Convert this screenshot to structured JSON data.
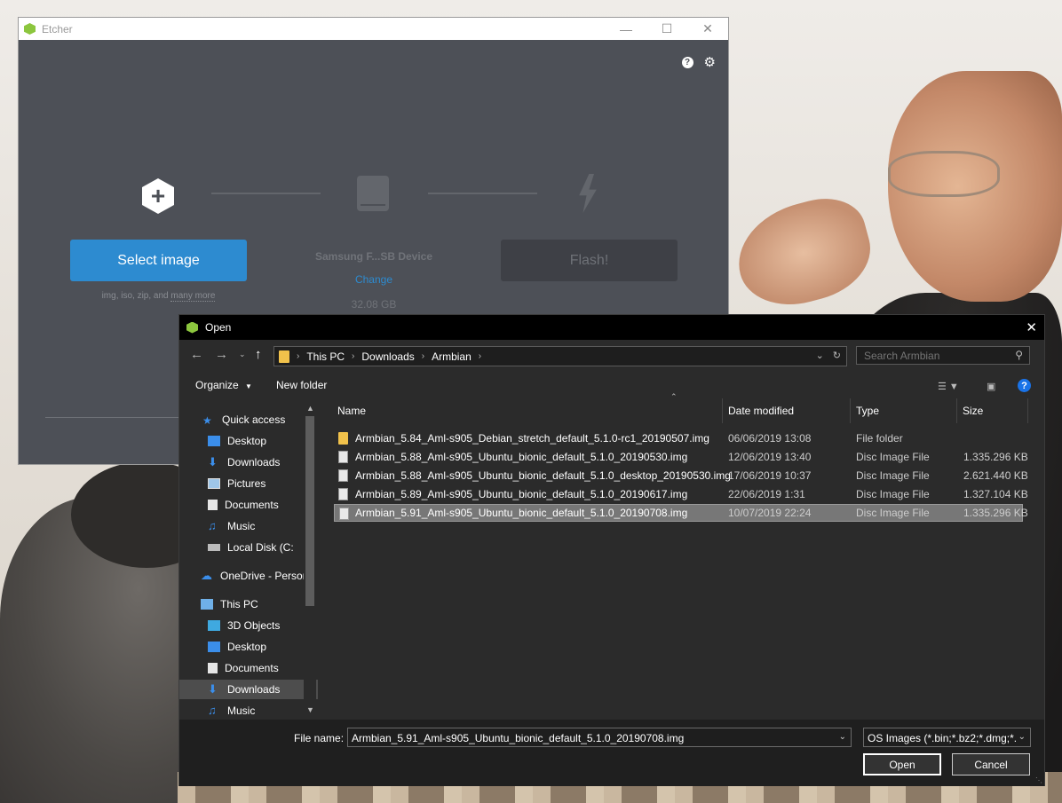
{
  "etcher": {
    "title": "Etcher",
    "help_icon_label": "?",
    "select_image_label": "Select image",
    "formats_text": "img, iso, zip, and",
    "formats_more": "many more",
    "drive_name": "Samsung F...SB Device",
    "drive_change": "Change",
    "drive_size": "32.08 GB",
    "flash_label": "Flash!"
  },
  "dialog": {
    "title": "Open",
    "breadcrumb": [
      "This PC",
      "Downloads",
      "Armbian"
    ],
    "search_placeholder": "Search Armbian",
    "organize_label": "Organize",
    "new_folder_label": "New folder",
    "help_label": "?",
    "nav": {
      "quick_access": "Quick access",
      "desktop": "Desktop",
      "downloads": "Downloads",
      "pictures": "Pictures",
      "documents": "Documents",
      "music": "Music",
      "local_disk": "Local Disk (C:",
      "onedrive": "OneDrive - Persor",
      "this_pc": "This PC",
      "objects3d": "3D Objects",
      "pc_desktop": "Desktop",
      "pc_documents": "Documents",
      "pc_downloads": "Downloads",
      "pc_music": "Music"
    },
    "columns": {
      "name": "Name",
      "date": "Date modified",
      "type": "Type",
      "size": "Size"
    },
    "files": [
      {
        "name": "Armbian_5.84_Aml-s905_Debian_stretch_default_5.1.0-rc1_20190507.img",
        "date": "06/06/2019 13:08",
        "type": "File folder",
        "size": ""
      },
      {
        "name": "Armbian_5.88_Aml-s905_Ubuntu_bionic_default_5.1.0_20190530.img",
        "date": "12/06/2019 13:40",
        "type": "Disc Image File",
        "size": "1.335.296 KB"
      },
      {
        "name": "Armbian_5.88_Aml-s905_Ubuntu_bionic_default_5.1.0_desktop_20190530.img",
        "date": "17/06/2019 10:37",
        "type": "Disc Image File",
        "size": "2.621.440 KB"
      },
      {
        "name": "Armbian_5.89_Aml-s905_Ubuntu_bionic_default_5.1.0_20190617.img",
        "date": "22/06/2019 1:31",
        "type": "Disc Image File",
        "size": "1.327.104 KB"
      },
      {
        "name": "Armbian_5.91_Aml-s905_Ubuntu_bionic_default_5.1.0_20190708.img",
        "date": "10/07/2019 22:24",
        "type": "Disc Image File",
        "size": "1.335.296 KB"
      }
    ],
    "file_name_label": "File name:",
    "file_name_value": "Armbian_5.91_Aml-s905_Ubuntu_bionic_default_5.1.0_20190708.img",
    "file_type_value": "OS Images (*.bin;*.bz2;*.dmg;*.",
    "open_label": "Open",
    "cancel_label": "Cancel"
  },
  "colors": {
    "etcher_bg": "#4d5057",
    "etcher_accent": "#2d8bd0",
    "dialog_bg": "#2b2b2b",
    "folder_yellow": "#f1c24b",
    "selection": "#777777"
  }
}
